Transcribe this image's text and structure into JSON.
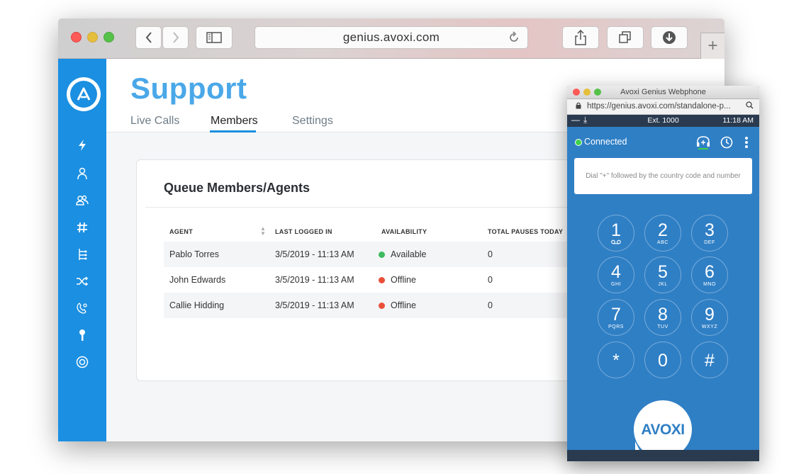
{
  "browser": {
    "url": "genius.avoxi.com",
    "colors": {
      "sidebar": "#1b8fe1",
      "title": "#4aa8e8"
    },
    "sidebar_icons": [
      "lightning-icon",
      "user-icon",
      "users-icon",
      "hash-icon",
      "tree-icon",
      "shuffle-icon",
      "phone-settings-icon",
      "key-icon",
      "lifebuoy-icon"
    ]
  },
  "page": {
    "title": "Support",
    "tabs": [
      {
        "label": "Live Calls",
        "active": false
      },
      {
        "label": "Members",
        "active": true
      },
      {
        "label": "Settings",
        "active": false
      }
    ]
  },
  "card": {
    "title": "Queue Members/Agents",
    "columns": [
      "AGENT",
      "LAST LOGGED IN",
      "AVAILABILITY",
      "TOTAL PAUSES TODAY"
    ],
    "rows": [
      {
        "agent": "Pablo Torres",
        "last_logged_in": "3/5/2019 - 11:13 AM",
        "availability": "Available",
        "status_color": "#3dbb5e",
        "pauses": "0"
      },
      {
        "agent": "John Edwards",
        "last_logged_in": "3/5/2019 - 11:13 AM",
        "availability": "Offline",
        "status_color": "#e9503a",
        "pauses": "0"
      },
      {
        "agent": "Callie Hidding",
        "last_logged_in": "3/5/2019 - 11:13 AM",
        "availability": "Offline",
        "status_color": "#e9503a",
        "pauses": "0"
      }
    ]
  },
  "phone": {
    "window_title": "Avoxi Genius Webphone",
    "url": "https://genius.avoxi.com/standalone-p...",
    "ext": "Ext. 1000",
    "time": "11:18 AM",
    "status": "Connected",
    "dial_placeholder": "Dial \"+\" followed by the country code and number",
    "keys": [
      {
        "digit": "1",
        "letters": ""
      },
      {
        "digit": "2",
        "letters": "ABC"
      },
      {
        "digit": "3",
        "letters": "DEF"
      },
      {
        "digit": "4",
        "letters": "GHI"
      },
      {
        "digit": "5",
        "letters": "JKL"
      },
      {
        "digit": "6",
        "letters": "MNO"
      },
      {
        "digit": "7",
        "letters": "PQRS"
      },
      {
        "digit": "8",
        "letters": "TUV"
      },
      {
        "digit": "9",
        "letters": "WXYZ"
      },
      {
        "digit": "*",
        "letters": ""
      },
      {
        "digit": "0",
        "letters": ""
      },
      {
        "digit": "#",
        "letters": ""
      }
    ],
    "brand": "AVOXI",
    "colors": {
      "background": "#2f7fc5",
      "status_bar": "#2a3a4f",
      "connected": "#3ed24a"
    }
  }
}
